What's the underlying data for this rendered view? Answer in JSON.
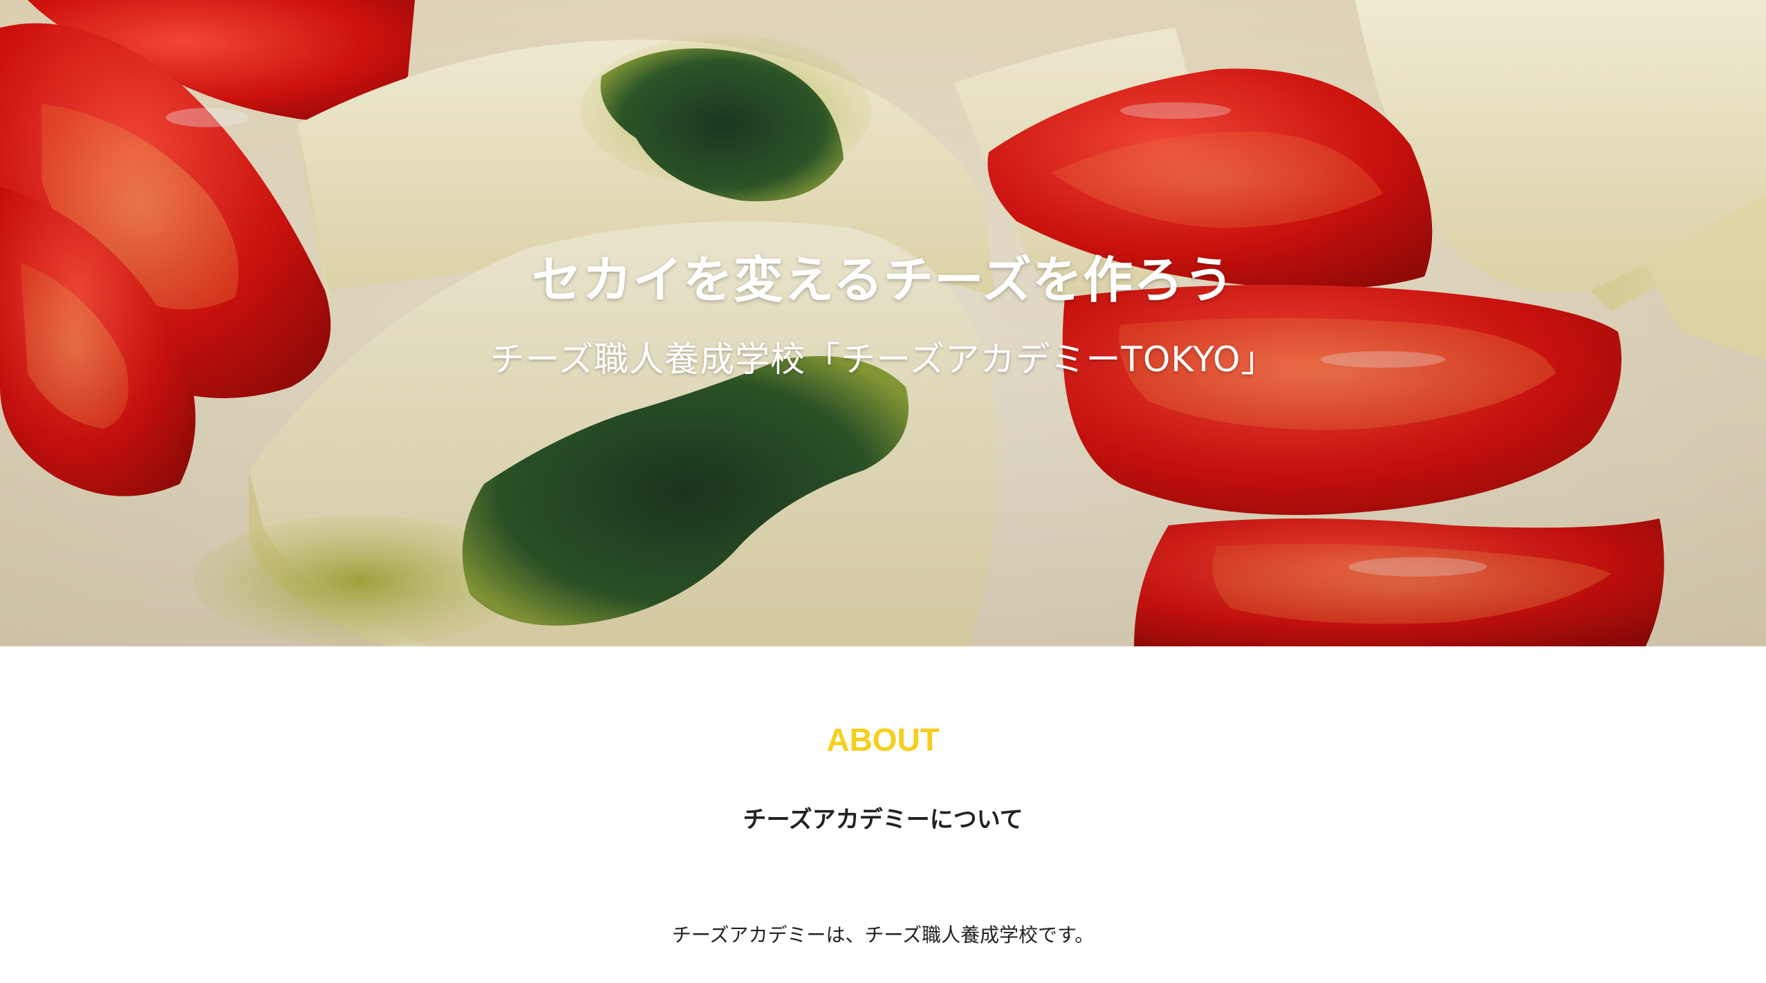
{
  "hero": {
    "title": "セカイを変えるチーズを作ろう",
    "subtitle": "チーズ職人養成学校「チーズアカデミーTOKYO」",
    "image": "caprese-cheese-tomato-photo"
  },
  "about": {
    "heading": "ABOUT",
    "subheading": "チーズアカデミーについて",
    "body": "チーズアカデミーは、チーズ職人養成学校です。"
  },
  "colors": {
    "accent": "#f5cf1c",
    "text": "#222222",
    "hero_text": "#ffffff",
    "background": "#ffffff"
  }
}
